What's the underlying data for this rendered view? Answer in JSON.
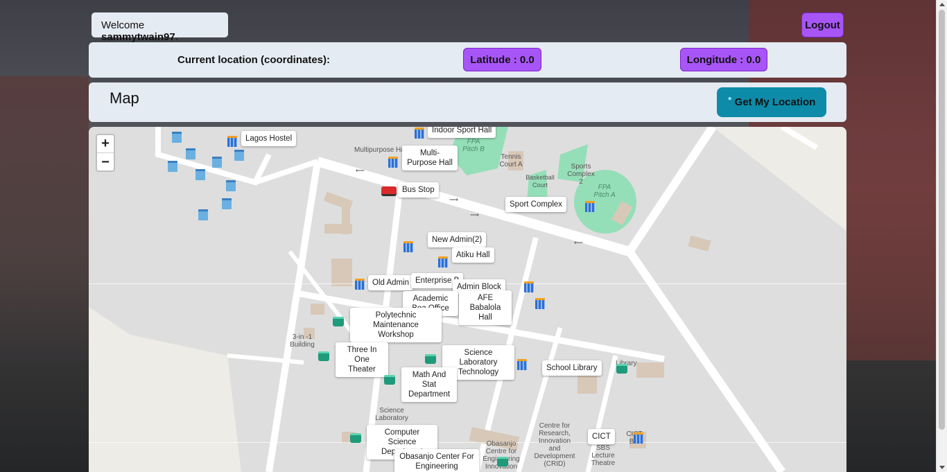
{
  "header": {
    "welcome_prefix": "Welcome ",
    "username": "sammytwain97",
    "welcome_suffix": ".",
    "logout_label": "Logout"
  },
  "location": {
    "label": "Current location (coordinates):",
    "latitude": "Latitude : 0.0",
    "longitude": "Longitude : 0.0"
  },
  "map_section": {
    "title": "Map",
    "locate_button": "Get My Location",
    "zoom_in": "+",
    "zoom_out": "−"
  },
  "map_labels": [
    "Lagos Hostel",
    "Multi-Purpose Hall",
    "Indoor Sport Hall",
    "Bus Stop",
    "Sport Complex",
    "New Admin(2)",
    "Atiku Hall",
    "Old Admin",
    "Enterprise B",
    "Admin Block",
    "Academic Boa Office",
    "AFE Babalola Hall",
    "Polytechnic Maintenance Workshop",
    "Three In One Theater",
    "Science Laboratory Technology",
    "Math And Stat Department",
    "School Library",
    "Computer Science Department",
    "Obasanjo Center For Engineering Innovation",
    "CICT"
  ],
  "map_texts": {
    "multipurpose": "Multipurpose Hall",
    "tennis": "Tennis Court A",
    "basketball": "Basketball Court",
    "sports2": "Sports Complex 2",
    "fpa_a": "FPA Pitch A",
    "fpa_b": "FPA Pitch B",
    "three_in_one": "3-in -1 Building",
    "science_lab": "Science Laboratory",
    "library": "Library",
    "obasanjo": "Obasanjo Centre for Engineering Innovation",
    "crid": "Centre for Research, Innovation and Development (CRID)",
    "sbs": "SBS Lecture Theatre",
    "cict_bui": "CICT Bui"
  },
  "colors": {
    "accent_purple": "#a855f7",
    "locate_teal": "#0e8ba8",
    "panel_bg": "#e5ebf2"
  }
}
